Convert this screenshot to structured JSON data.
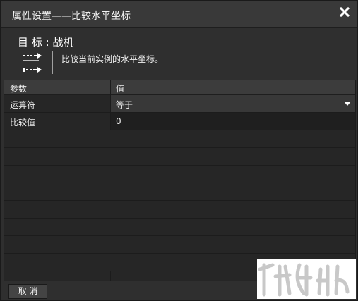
{
  "window": {
    "title": "属性设置——比较水平坐标",
    "close_icon": "close-icon"
  },
  "target": {
    "label": "目 标",
    "separator": ":",
    "name": "战机",
    "icon": "compare-horizontal-icon",
    "description": "比较当前实例的水平坐标。"
  },
  "grid": {
    "columns": [
      "参数",
      "值"
    ],
    "rows": [
      {
        "param": "运算符",
        "value": "等于",
        "type": "select"
      },
      {
        "param": "比较值",
        "value": "0",
        "type": "input"
      }
    ]
  },
  "footer": {
    "cancel_label": "取 消"
  },
  "colors": {
    "dialog_bg": "#2f2f2f",
    "titlebar_bg": "#393939",
    "grid_bg": "#262626",
    "header_bg": "#3c3c3c",
    "input_bg": "#1f1f1f",
    "text": "#eeeeee"
  }
}
